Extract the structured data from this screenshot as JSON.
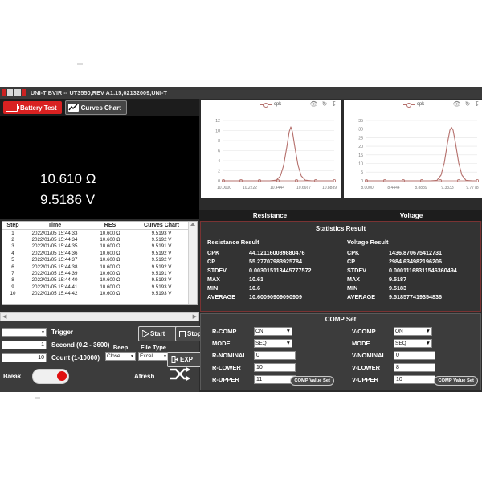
{
  "window": {
    "title": "UNI-T BVIR -- UT3550,REV A1.15,02132009,UNI-T",
    "logo_text": "UNI-T"
  },
  "tabs": [
    {
      "label": "Battery Test",
      "icon": "battery-icon",
      "active": true
    },
    {
      "label": "Curves Chart",
      "icon": "line-chart-icon",
      "active": false
    }
  ],
  "readout": {
    "resistance": "10.610 Ω",
    "voltage": "9.5186 V"
  },
  "charts": {
    "toolbar_icons": [
      "eye-icon",
      "refresh-icon",
      "download-icon"
    ],
    "legend_label": "cpk"
  },
  "chart_data": [
    {
      "type": "line",
      "title": "Resistance",
      "legend": [
        "cpk"
      ],
      "legend_position": "top-center",
      "grid": true,
      "xlabel": "",
      "ylabel": "",
      "xlim": [
        10.0,
        11.0
      ],
      "ylim": [
        0,
        12
      ],
      "xticks": [
        "10.0000",
        "10.2222",
        "10.4444",
        "10.6667",
        "10.8889"
      ],
      "yticks": [
        0,
        2,
        4,
        6,
        8,
        10,
        12
      ],
      "x": [
        10.0,
        10.1111,
        10.2222,
        10.3333,
        10.4444,
        10.5556,
        10.6111,
        10.6389,
        10.6667,
        10.6944,
        10.7222,
        10.7778,
        10.8889,
        11.0
      ],
      "y": [
        0,
        0,
        0,
        0,
        0,
        0.2,
        3.0,
        8.0,
        11.2,
        8.0,
        3.0,
        0.2,
        0,
        0
      ],
      "series": [
        {
          "name": "cpk",
          "color": "#b5706c",
          "values": [
            0,
            0,
            0,
            0,
            0,
            0.2,
            3.0,
            8.0,
            11.2,
            8.0,
            3.0,
            0.2,
            0,
            0
          ]
        }
      ]
    },
    {
      "type": "line",
      "title": "Voltage",
      "legend": [
        "cpk"
      ],
      "legend_position": "top-center",
      "grid": true,
      "xlabel": "",
      "ylabel": "",
      "xlim": [
        8.0,
        10.0
      ],
      "ylim": [
        0,
        35
      ],
      "xticks": [
        "8.0000",
        "8.4444",
        "8.8889",
        "9.3333",
        "9.7778"
      ],
      "yticks": [
        0,
        5,
        10,
        15,
        20,
        25,
        30,
        35
      ],
      "x": [
        8.0,
        8.4444,
        8.8889,
        9.1111,
        9.3333,
        9.4444,
        9.5,
        9.5278,
        9.5556,
        9.5833,
        9.6111,
        9.6667,
        9.7778,
        10.0
      ],
      "y": [
        0,
        0,
        0,
        0,
        0,
        0.3,
        6.0,
        18.0,
        31.0,
        18.0,
        6.0,
        0.3,
        0,
        0
      ],
      "series": [
        {
          "name": "cpk",
          "color": "#b5706c",
          "values": [
            0,
            0,
            0,
            0,
            0,
            0.3,
            6.0,
            18.0,
            31.0,
            18.0,
            6.0,
            0.3,
            0,
            0
          ]
        }
      ]
    }
  ],
  "table": {
    "headers": [
      "Step",
      "Time",
      "RES",
      "Curves Chart"
    ],
    "rows": [
      [
        "1",
        "2022/01/05 15:44:33",
        "10.600 Ω",
        "9.5193 V"
      ],
      [
        "2",
        "2022/01/05 15:44:34",
        "10.600 Ω",
        "9.5192 V"
      ],
      [
        "3",
        "2022/01/05 15:44:35",
        "10.600 Ω",
        "9.5191 V"
      ],
      [
        "4",
        "2022/01/05 15:44:36",
        "10.600 Ω",
        "9.5192 V"
      ],
      [
        "5",
        "2022/01/05 15:44:37",
        "10.600 Ω",
        "9.5192 V"
      ],
      [
        "6",
        "2022/01/05 15:44:38",
        "10.600 Ω",
        "9.5192 V"
      ],
      [
        "7",
        "2022/01/05 15:44:39",
        "10.600 Ω",
        "9.5191 V"
      ],
      [
        "8",
        "2022/01/05 15:44:40",
        "10.600 Ω",
        "9.5193 V"
      ],
      [
        "9",
        "2022/01/05 15:44:41",
        "10.600 Ω",
        "9.5193 V"
      ],
      [
        "10",
        "2022/01/05 15:44:42",
        "10.600 Ω",
        "9.5193 V"
      ]
    ]
  },
  "controls": {
    "trigger_value": "",
    "trigger_label": "Trigger",
    "second_value": "1",
    "second_label": "Second (0.2 - 3600)",
    "count_value": "10",
    "count_label": "Count (1-10000)",
    "beep_label": "Beep",
    "beep_value": "Close",
    "filetype_label": "File Type",
    "filetype_value": "Excel",
    "start_label": "Start",
    "stop_label": "Stop",
    "export_label": "EXP",
    "break_label": "Break",
    "afresh_label": "Afresh"
  },
  "sections": {
    "resistance_header": "Resistance",
    "voltage_header": "Voltage"
  },
  "statistics": {
    "title": "Statistics Result",
    "resistance": {
      "heading": "Resistance Result",
      "rows": [
        {
          "key": "CPK",
          "value": "44.121160089880476"
        },
        {
          "key": "CP",
          "value": "55.27707983925784"
        },
        {
          "key": "STDEV",
          "value": "0.003015113445777572"
        },
        {
          "key": "MAX",
          "value": "10.61"
        },
        {
          "key": "MIN",
          "value": "10.6"
        },
        {
          "key": "AVERAGE",
          "value": "10.60090909090909"
        }
      ]
    },
    "voltage": {
      "heading": "Voltage Result",
      "rows": [
        {
          "key": "CPK",
          "value": "1436.870675412731"
        },
        {
          "key": "CP",
          "value": "2984.634982196206"
        },
        {
          "key": "STDEV",
          "value": "0.00011168311546360494"
        },
        {
          "key": "MAX",
          "value": "9.5187"
        },
        {
          "key": "MIN",
          "value": "9.5183"
        },
        {
          "key": "AVERAGE",
          "value": "9.518577419354836"
        }
      ]
    }
  },
  "comp_set": {
    "title": "COMP Set",
    "value_set_button": "COMP Value Set",
    "resistance": [
      {
        "label": "R-COMP",
        "value": "ON",
        "type": "select"
      },
      {
        "label": "MODE",
        "value": "SEQ",
        "type": "select"
      },
      {
        "label": "R-NOMINAL",
        "value": "0",
        "type": "input"
      },
      {
        "label": "R-LOWER",
        "value": "10",
        "type": "input"
      },
      {
        "label": "R-UPPER",
        "value": "11",
        "type": "input"
      }
    ],
    "voltage": [
      {
        "label": "V-COMP",
        "value": "ON",
        "type": "select"
      },
      {
        "label": "MODE",
        "value": "SEQ",
        "type": "select"
      },
      {
        "label": "V-NOMINAL",
        "value": "0",
        "type": "input"
      },
      {
        "label": "V-LOWER",
        "value": "8",
        "type": "input"
      },
      {
        "label": "V-UPPER",
        "value": "10",
        "type": "input"
      }
    ]
  }
}
